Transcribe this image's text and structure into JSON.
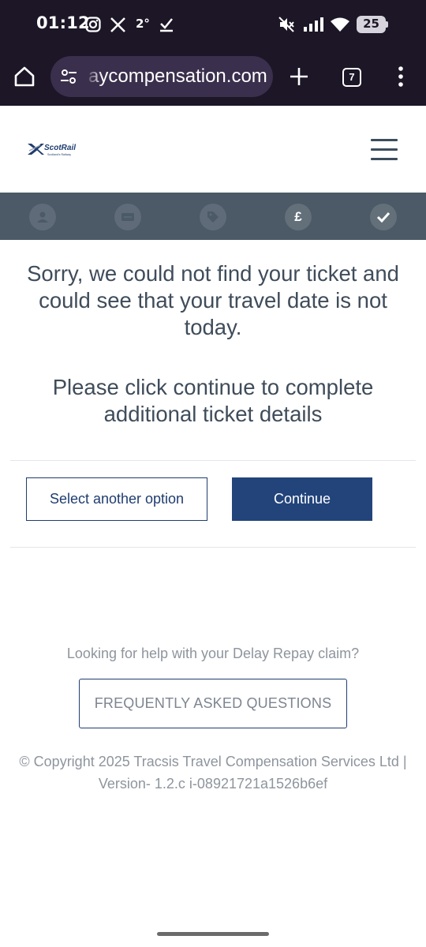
{
  "status_bar": {
    "time": "01:12",
    "temperature": "2°",
    "battery": "25",
    "icons": [
      "instagram-icon",
      "x-icon",
      "check-icon",
      "mute-icon",
      "signal-icon",
      "wifi-icon",
      "battery-icon"
    ]
  },
  "browser": {
    "url": "aycompensation.com",
    "tab_count": "7"
  },
  "site": {
    "logo_text": "ScotRail",
    "logo_subtext": "Scotland's Railway",
    "steps": [
      {
        "icon": "user-icon",
        "state": "inactive"
      },
      {
        "icon": "ticket-icon",
        "state": "inactive"
      },
      {
        "icon": "tag-icon",
        "state": "inactive"
      },
      {
        "icon": "pound-icon",
        "label": "£",
        "state": "active"
      },
      {
        "icon": "check-icon",
        "state": "active"
      }
    ]
  },
  "main": {
    "message_line1": "Sorry, we could not find your ticket and could see that your travel date is not today.",
    "message_line2": "Please click continue to complete additional ticket details",
    "select_another_label": "Select another option",
    "continue_label": "Continue"
  },
  "footer": {
    "help_text": "Looking for help with your Delay Repay claim?",
    "faq_label": "FREQUENTLY ASKED QUESTIONS",
    "copyright": "© Copyright 2025 Tracsis Travel Compensation Services Ltd | Version- 1.2.c i-08921721a1526b6ef"
  },
  "colors": {
    "primary": "#22447b",
    "steps_bar": "#4b5a66",
    "text": "#3f4c5a",
    "status_bar": "#1c1626"
  }
}
